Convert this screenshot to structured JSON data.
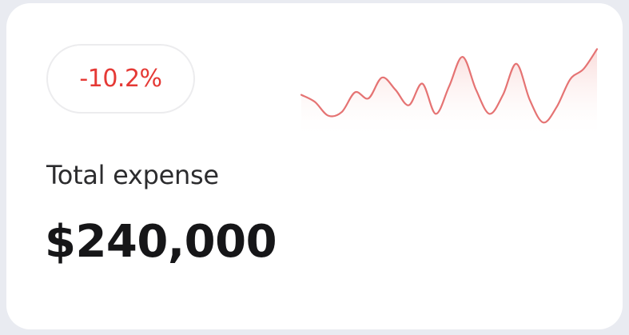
{
  "card": {
    "change_badge": "-10.2%",
    "label": "Total expense",
    "amount": "$240,000"
  },
  "sparkline": {
    "trend": "down",
    "line_color": "#e57373",
    "values": [
      0.42,
      0.34,
      0.18,
      0.22,
      0.45,
      0.38,
      0.62,
      0.48,
      0.3,
      0.55,
      0.2,
      0.52,
      0.86,
      0.48,
      0.2,
      0.42,
      0.78,
      0.36,
      0.1,
      0.28,
      0.6,
      0.72,
      0.95
    ]
  },
  "colors": {
    "background": "#e9ebf1",
    "card": "#ffffff",
    "negative": "#e53935"
  }
}
